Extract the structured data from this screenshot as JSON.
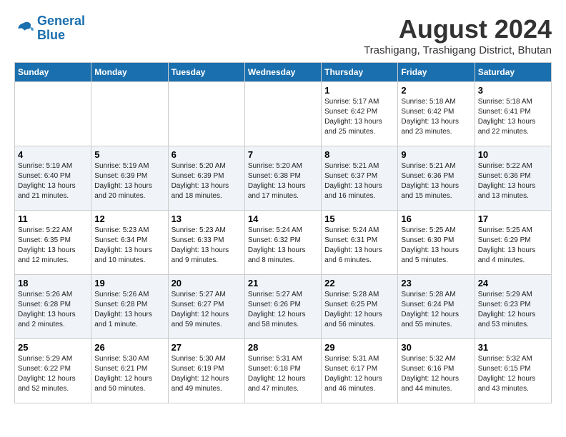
{
  "header": {
    "logo_line1": "General",
    "logo_line2": "Blue",
    "main_title": "August 2024",
    "subtitle": "Trashigang, Trashigang District, Bhutan"
  },
  "days_of_week": [
    "Sunday",
    "Monday",
    "Tuesday",
    "Wednesday",
    "Thursday",
    "Friday",
    "Saturday"
  ],
  "weeks": [
    [
      {
        "day": "",
        "info": ""
      },
      {
        "day": "",
        "info": ""
      },
      {
        "day": "",
        "info": ""
      },
      {
        "day": "",
        "info": ""
      },
      {
        "day": "1",
        "info": "Sunrise: 5:17 AM\nSunset: 6:42 PM\nDaylight: 13 hours\nand 25 minutes."
      },
      {
        "day": "2",
        "info": "Sunrise: 5:18 AM\nSunset: 6:42 PM\nDaylight: 13 hours\nand 23 minutes."
      },
      {
        "day": "3",
        "info": "Sunrise: 5:18 AM\nSunset: 6:41 PM\nDaylight: 13 hours\nand 22 minutes."
      }
    ],
    [
      {
        "day": "4",
        "info": "Sunrise: 5:19 AM\nSunset: 6:40 PM\nDaylight: 13 hours\nand 21 minutes."
      },
      {
        "day": "5",
        "info": "Sunrise: 5:19 AM\nSunset: 6:39 PM\nDaylight: 13 hours\nand 20 minutes."
      },
      {
        "day": "6",
        "info": "Sunrise: 5:20 AM\nSunset: 6:39 PM\nDaylight: 13 hours\nand 18 minutes."
      },
      {
        "day": "7",
        "info": "Sunrise: 5:20 AM\nSunset: 6:38 PM\nDaylight: 13 hours\nand 17 minutes."
      },
      {
        "day": "8",
        "info": "Sunrise: 5:21 AM\nSunset: 6:37 PM\nDaylight: 13 hours\nand 16 minutes."
      },
      {
        "day": "9",
        "info": "Sunrise: 5:21 AM\nSunset: 6:36 PM\nDaylight: 13 hours\nand 15 minutes."
      },
      {
        "day": "10",
        "info": "Sunrise: 5:22 AM\nSunset: 6:36 PM\nDaylight: 13 hours\nand 13 minutes."
      }
    ],
    [
      {
        "day": "11",
        "info": "Sunrise: 5:22 AM\nSunset: 6:35 PM\nDaylight: 13 hours\nand 12 minutes."
      },
      {
        "day": "12",
        "info": "Sunrise: 5:23 AM\nSunset: 6:34 PM\nDaylight: 13 hours\nand 10 minutes."
      },
      {
        "day": "13",
        "info": "Sunrise: 5:23 AM\nSunset: 6:33 PM\nDaylight: 13 hours\nand 9 minutes."
      },
      {
        "day": "14",
        "info": "Sunrise: 5:24 AM\nSunset: 6:32 PM\nDaylight: 13 hours\nand 8 minutes."
      },
      {
        "day": "15",
        "info": "Sunrise: 5:24 AM\nSunset: 6:31 PM\nDaylight: 13 hours\nand 6 minutes."
      },
      {
        "day": "16",
        "info": "Sunrise: 5:25 AM\nSunset: 6:30 PM\nDaylight: 13 hours\nand 5 minutes."
      },
      {
        "day": "17",
        "info": "Sunrise: 5:25 AM\nSunset: 6:29 PM\nDaylight: 13 hours\nand 4 minutes."
      }
    ],
    [
      {
        "day": "18",
        "info": "Sunrise: 5:26 AM\nSunset: 6:28 PM\nDaylight: 13 hours\nand 2 minutes."
      },
      {
        "day": "19",
        "info": "Sunrise: 5:26 AM\nSunset: 6:28 PM\nDaylight: 13 hours\nand 1 minute."
      },
      {
        "day": "20",
        "info": "Sunrise: 5:27 AM\nSunset: 6:27 PM\nDaylight: 12 hours\nand 59 minutes."
      },
      {
        "day": "21",
        "info": "Sunrise: 5:27 AM\nSunset: 6:26 PM\nDaylight: 12 hours\nand 58 minutes."
      },
      {
        "day": "22",
        "info": "Sunrise: 5:28 AM\nSunset: 6:25 PM\nDaylight: 12 hours\nand 56 minutes."
      },
      {
        "day": "23",
        "info": "Sunrise: 5:28 AM\nSunset: 6:24 PM\nDaylight: 12 hours\nand 55 minutes."
      },
      {
        "day": "24",
        "info": "Sunrise: 5:29 AM\nSunset: 6:23 PM\nDaylight: 12 hours\nand 53 minutes."
      }
    ],
    [
      {
        "day": "25",
        "info": "Sunrise: 5:29 AM\nSunset: 6:22 PM\nDaylight: 12 hours\nand 52 minutes."
      },
      {
        "day": "26",
        "info": "Sunrise: 5:30 AM\nSunset: 6:21 PM\nDaylight: 12 hours\nand 50 minutes."
      },
      {
        "day": "27",
        "info": "Sunrise: 5:30 AM\nSunset: 6:19 PM\nDaylight: 12 hours\nand 49 minutes."
      },
      {
        "day": "28",
        "info": "Sunrise: 5:31 AM\nSunset: 6:18 PM\nDaylight: 12 hours\nand 47 minutes."
      },
      {
        "day": "29",
        "info": "Sunrise: 5:31 AM\nSunset: 6:17 PM\nDaylight: 12 hours\nand 46 minutes."
      },
      {
        "day": "30",
        "info": "Sunrise: 5:32 AM\nSunset: 6:16 PM\nDaylight: 12 hours\nand 44 minutes."
      },
      {
        "day": "31",
        "info": "Sunrise: 5:32 AM\nSunset: 6:15 PM\nDaylight: 12 hours\nand 43 minutes."
      }
    ]
  ]
}
